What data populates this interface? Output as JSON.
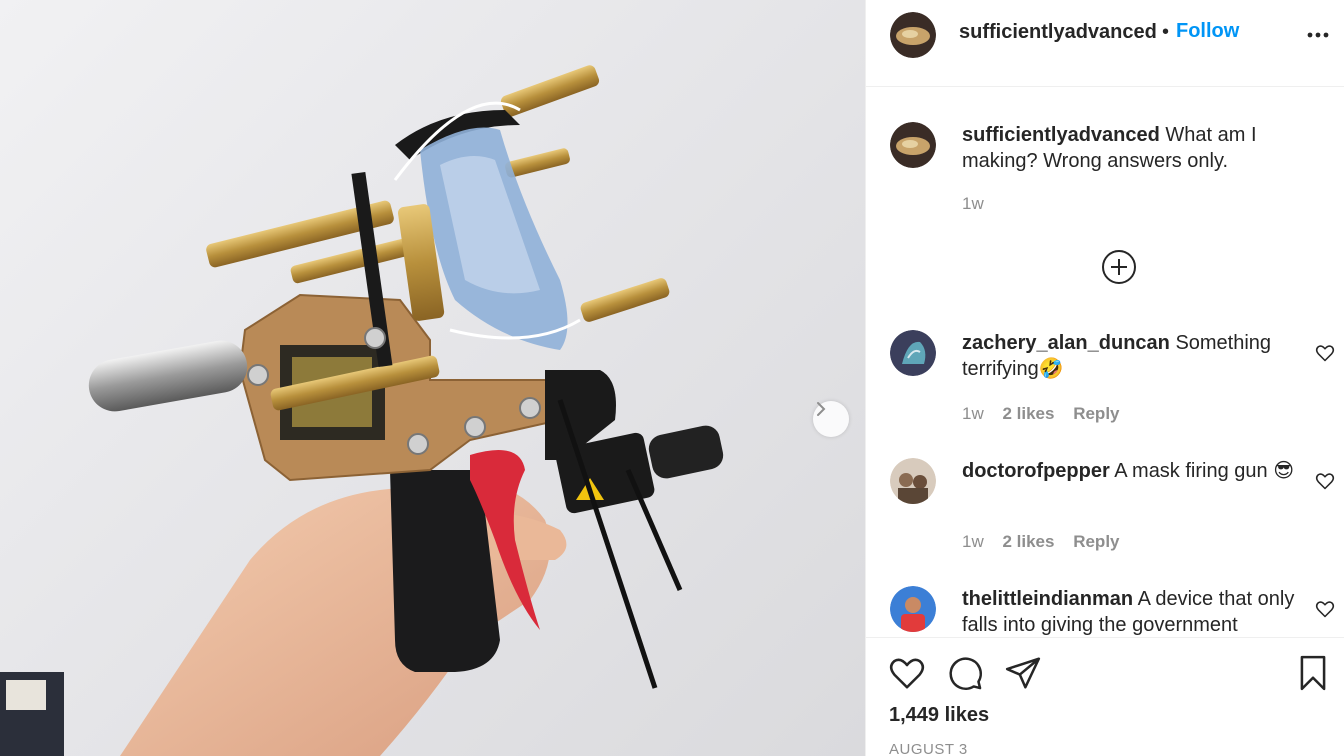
{
  "post": {
    "username": "sufficientlyadvanced",
    "follow_label": "Follow",
    "header_separator": "•",
    "caption": {
      "username": "sufficientlyadvanced",
      "text": "What am I making? Wrong answers only.",
      "time": "1w"
    },
    "likes_text": "1,449 likes",
    "date_text": "AUGUST 3"
  },
  "comments": [
    {
      "username": "zachery_alan_duncan",
      "text": "Something terrifying🤣",
      "time": "1w",
      "likes": "2 likes",
      "reply": "Reply",
      "avatar_color": "#3b3f5c"
    },
    {
      "username": "doctorofpepper",
      "text": "A mask firing gun 😎",
      "time": "1w",
      "likes": "2 likes",
      "reply": "Reply",
      "avatar_color": "#8a6b52"
    },
    {
      "username": "thelittleindianman",
      "text": "A device that only falls into giving the government",
      "time": "",
      "likes": "",
      "reply": "",
      "avatar_color": "#3c7fd6"
    }
  ],
  "icons": {
    "more": "more-options-icon",
    "next": "chevron-right-icon",
    "load_more": "plus-circle-icon",
    "like": "heart-icon",
    "comment": "comment-icon",
    "share": "send-icon",
    "save": "bookmark-icon"
  },
  "colors": {
    "accent": "#0095f6",
    "text": "#262626",
    "secondary": "#8e8e8e",
    "divider": "#efefef"
  }
}
